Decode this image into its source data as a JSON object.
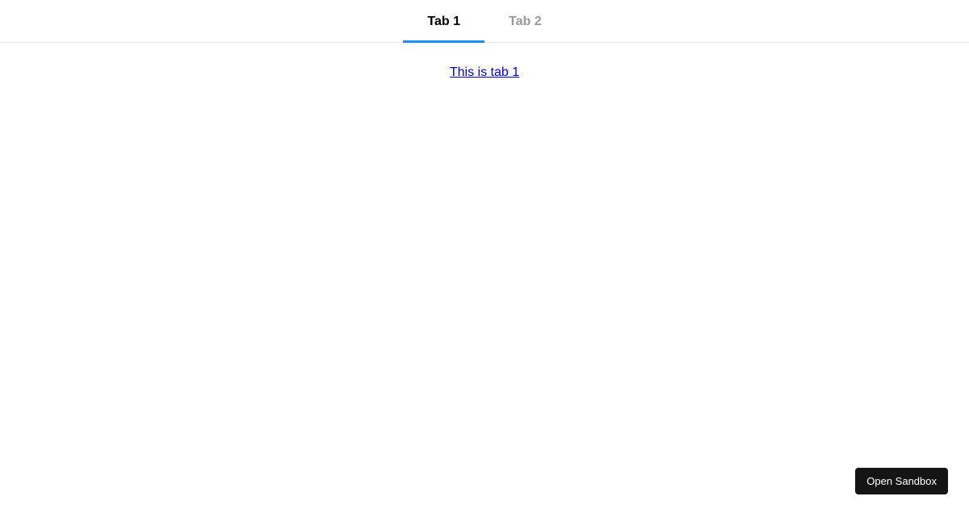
{
  "tabs": {
    "items": [
      {
        "label": "Tab 1",
        "active": true
      },
      {
        "label": "Tab 2",
        "active": false
      }
    ]
  },
  "content": {
    "link_text": "This is tab 1"
  },
  "footer": {
    "open_sandbox_label": "Open Sandbox"
  }
}
